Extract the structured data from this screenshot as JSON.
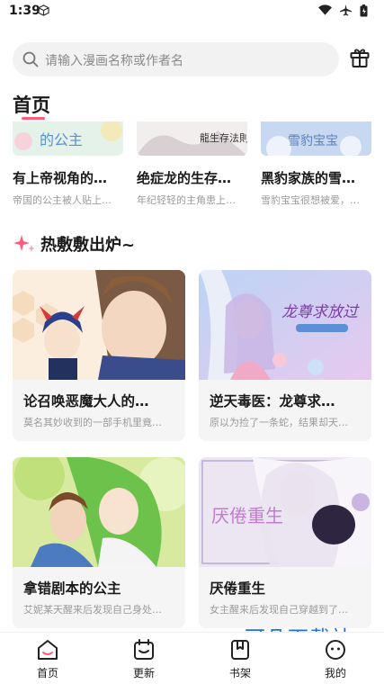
{
  "status_bar": {
    "time": "1:39"
  },
  "search": {
    "placeholder": "请输入漫画名称或作者名"
  },
  "home": {
    "title": "首页"
  },
  "featured_row": [
    {
      "title": "有上帝视角的…",
      "desc": "帝国的公主被人贴上…",
      "cover_text": "的公主"
    },
    {
      "title": "绝症龙的生存…",
      "desc": "年纪轻轻的主角患上…",
      "cover_text": "龍生存法則"
    },
    {
      "title": "黑豹家族的雪…",
      "desc": "雪豹宝宝很想被爱，…",
      "cover_text": "雪豹宝宝"
    }
  ],
  "hot_section": {
    "title": "热敷敷出炉~"
  },
  "comics": [
    {
      "title": "论召唤恶魔大人的…",
      "desc": "莫名其妙收到的一部手机里竟…"
    },
    {
      "title": "逆天毒医：龙尊求…",
      "desc": "原以为捡了一条蛇，结果却天…",
      "cover_text": "龙尊求放过"
    },
    {
      "title": "拿错剧本的公主",
      "desc": "艾妮某天醒来后发现自己身处…"
    },
    {
      "title": "厌倦重生",
      "desc": "女主醒来后发现自己穿越到了…",
      "cover_text": "厌倦重生"
    }
  ],
  "watermark": "可凡下载站",
  "tabs": [
    {
      "label": "首页",
      "icon": "home-icon"
    },
    {
      "label": "更新",
      "icon": "calendar-icon"
    },
    {
      "label": "书架",
      "icon": "bookmark-icon"
    },
    {
      "label": "我的",
      "icon": "profile-icon"
    }
  ],
  "colors": {
    "accent": "#ff5c7a",
    "watermark": "#1e6fd9",
    "card_bg": "#f5f5f5"
  }
}
